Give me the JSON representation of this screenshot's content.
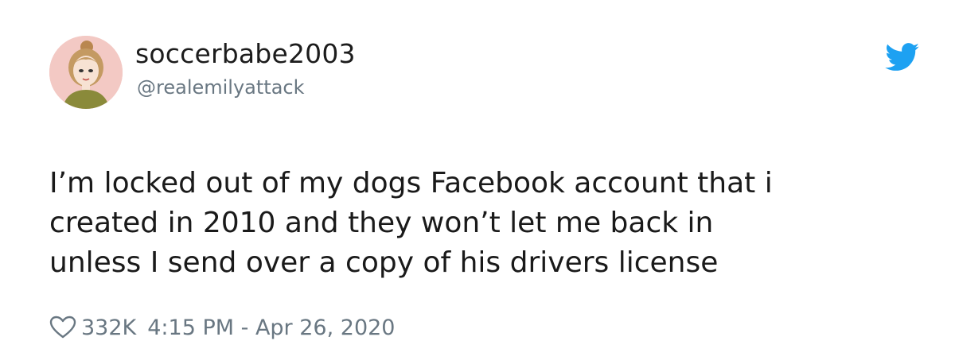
{
  "tweet": {
    "display_name": "soccerbabe2003",
    "handle": "@realemilyattack",
    "text": "I’m locked out of my dogs Facebook account that i\ncreated in 2010 and they won’t let me back in\nunless I send over a copy of his drivers license",
    "likes": "332K",
    "timestamp": "4:15 PM - Apr 26, 2020"
  },
  "icons": {
    "bird": "twitter-bird-icon",
    "heart": "heart-outline-icon"
  },
  "colors": {
    "brand_blue": "#1da1f2",
    "name_text": "#1c1c1c",
    "muted_text": "#697782",
    "avatar_bg": "#f3c9c4"
  }
}
